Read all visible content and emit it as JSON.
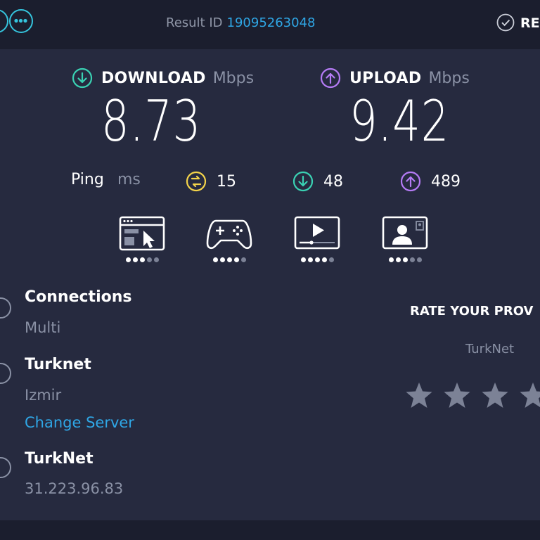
{
  "topbar": {
    "result_id_label": "Result ID",
    "result_id_value": "19095263048",
    "results_label": "RE"
  },
  "download": {
    "label": "DOWNLOAD",
    "unit": "Mbps",
    "value": "8.73",
    "icon": "download-arrow-icon",
    "color": "#3ad1b3"
  },
  "upload": {
    "label": "UPLOAD",
    "unit": "Mbps",
    "value": "9.42",
    "icon": "upload-arrow-icon",
    "color": "#b57bf5"
  },
  "ping": {
    "label": "Ping",
    "unit": "ms",
    "idle": "15",
    "download": "48",
    "upload": "489",
    "idle_color": "#f3d34a"
  },
  "use_cases": [
    {
      "icon": "web-browsing-icon",
      "rating": 3,
      "max": 5
    },
    {
      "icon": "gaming-icon",
      "rating": 4,
      "max": 5
    },
    {
      "icon": "streaming-icon",
      "rating": 4,
      "max": 5
    },
    {
      "icon": "video-chat-icon",
      "rating": 3,
      "max": 5
    }
  ],
  "connections": {
    "title": "Connections",
    "value": "Multi",
    "icon": "connections-icon"
  },
  "server": {
    "title": "Turknet",
    "location": "Izmir",
    "change_label": "Change Server",
    "icon": "globe-icon"
  },
  "provider": {
    "title": "TurkNet",
    "ip": "31.223.96.83",
    "icon": "user-icon"
  },
  "rating": {
    "title": "RATE YOUR PROV",
    "provider": "TurkNet",
    "stars_visible": 4
  }
}
